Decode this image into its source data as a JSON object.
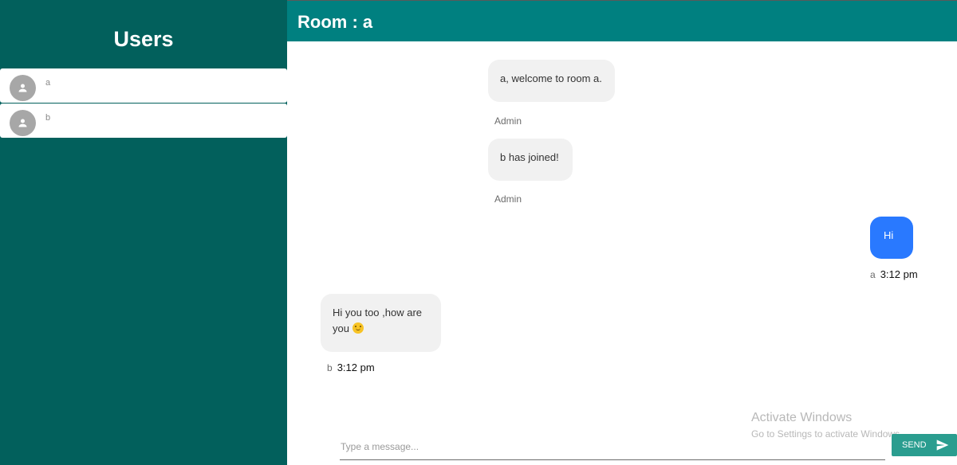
{
  "sidebar": {
    "title": "Users",
    "users": [
      {
        "name": "a"
      },
      {
        "name": "b"
      }
    ]
  },
  "header": {
    "room_title": "Room : a"
  },
  "messages": [
    {
      "text": "a, welcome to room a.",
      "sender": "Admin",
      "time": ""
    },
    {
      "text": "b has joined!",
      "sender": "Admin",
      "time": ""
    },
    {
      "text": "Hi",
      "sender": "a",
      "time": "3:12 pm"
    },
    {
      "text": "Hi you too ,how are you",
      "emoji": "slightly-smiling-face-icon",
      "sender": "b",
      "time": "3:12 pm"
    }
  ],
  "composer": {
    "placeholder": "Type a message...",
    "send_label": "SEND"
  },
  "watermark": {
    "title": "Activate Windows",
    "subtitle": "Go to Settings to activate Windows."
  },
  "colors": {
    "sidebar_bg": "#02605c",
    "header_bg": "#008080",
    "my_bubble": "#2979ff",
    "other_bubble": "#f1f1f1",
    "send_button": "#2a9d8f"
  }
}
